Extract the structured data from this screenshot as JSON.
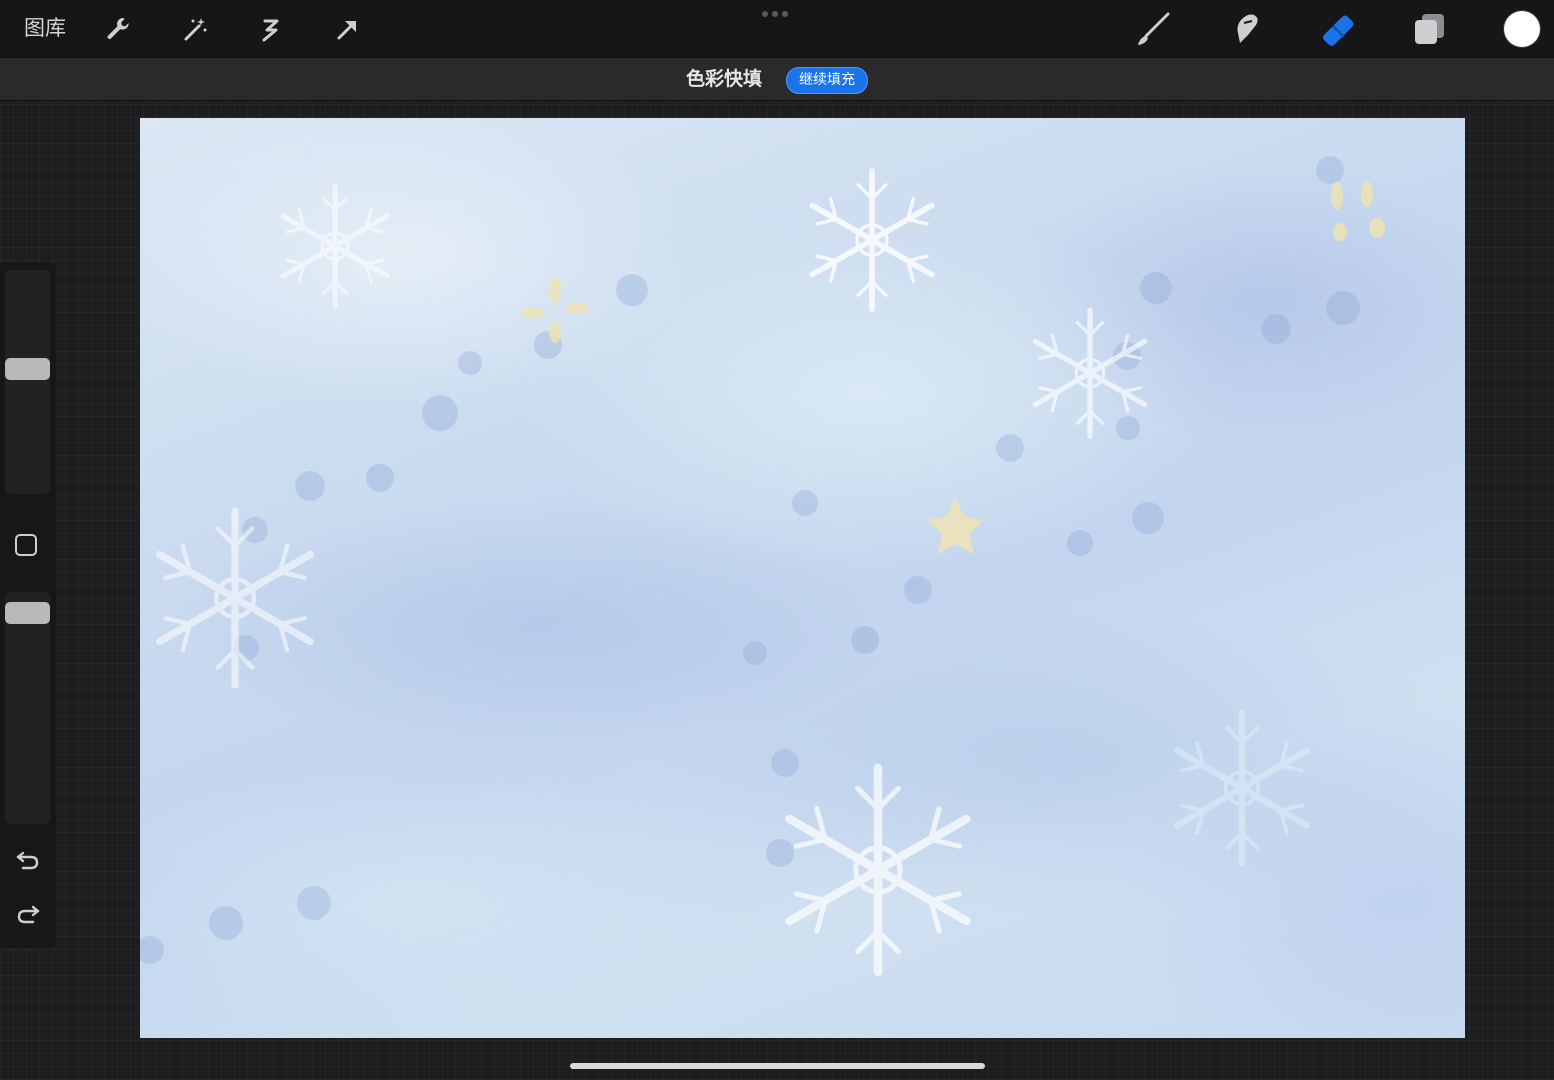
{
  "topbar": {
    "gallery_label": "图库",
    "tools_left": [
      "wrench-icon",
      "magic-wand-icon",
      "selection-icon",
      "transform-arrow-icon"
    ],
    "tools_right": [
      "brush-icon",
      "smudge-icon",
      "eraser-icon",
      "layers-icon"
    ],
    "active_tool": "eraser-icon",
    "accent_color": "#1a73e8",
    "current_color": "#ffffff"
  },
  "subbar": {
    "title": "色彩快填",
    "continue_fill_label": "继续填充"
  },
  "sidebar": {
    "controls": [
      "brush-size-slider",
      "modify-button",
      "opacity-slider",
      "undo-icon",
      "redo-icon"
    ]
  },
  "canvas": {
    "description_colors": [
      "#dbe7f3",
      "#c3d5ee",
      "#ffffff"
    ]
  }
}
